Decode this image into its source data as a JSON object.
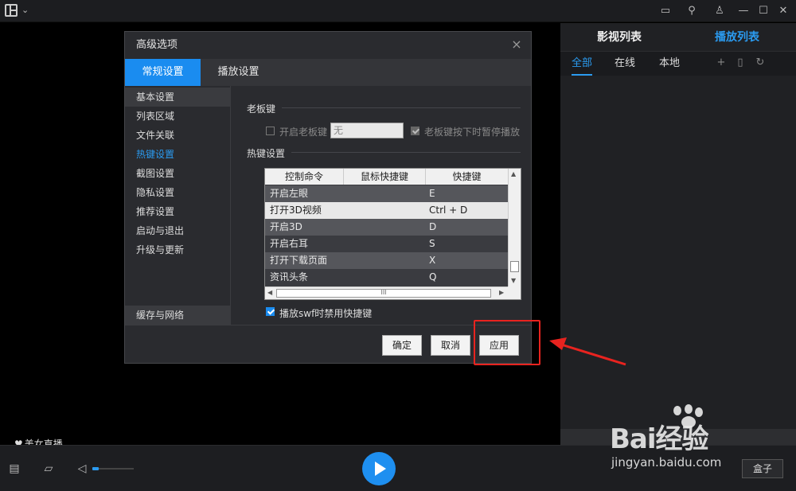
{
  "topbar": {
    "icons": [
      "app-logo-icon",
      "chevron-down-icon",
      "message-icon",
      "pin-icon",
      "skin-icon",
      "minimize-icon",
      "maximize-icon",
      "close-icon"
    ]
  },
  "video": {
    "live_tag": "美女直播"
  },
  "right_panel": {
    "tabs": [
      "影视列表",
      "播放列表"
    ],
    "active_tab": "播放列表",
    "subtabs": [
      "全部",
      "在线",
      "本地"
    ],
    "active_subtab": "全部"
  },
  "dialog": {
    "title": "高级选项",
    "tabs": [
      "常规设置",
      "播放设置"
    ],
    "active_tab": "常规设置",
    "sidebar": {
      "items": [
        "基本设置",
        "列表区域",
        "文件关联",
        "热键设置",
        "截图设置",
        "隐私设置",
        "推荐设置",
        "启动与退出",
        "升级与更新"
      ],
      "active": "热键设置",
      "bottom_item": "缓存与网络"
    },
    "boss_key": {
      "section_label": "老板键",
      "enable_label": "开启老板键",
      "enable_checked": false,
      "input_value": "无",
      "pause_label": "老板键按下时暂停播放",
      "pause_checked": true
    },
    "hotkeys": {
      "section_label": "热键设置",
      "columns": [
        "控制命令",
        "鼠标快捷键",
        "快捷键"
      ],
      "rows": [
        {
          "command": "开启左眼",
          "mouse": "",
          "key": "E"
        },
        {
          "command": "打开3D视频",
          "mouse": "",
          "key": "Ctrl + D"
        },
        {
          "command": "开启3D",
          "mouse": "",
          "key": "D"
        },
        {
          "command": "开启右耳",
          "mouse": "",
          "key": "S"
        },
        {
          "command": "打开下载页面",
          "mouse": "",
          "key": "X"
        },
        {
          "command": "资讯头条",
          "mouse": "",
          "key": "Q"
        }
      ],
      "selected_row": 1,
      "scroll_grip": "III"
    },
    "swf_option": {
      "label": "播放swf时禁用快捷键",
      "checked": true
    },
    "buttons": {
      "ok": "确定",
      "cancel": "取消",
      "apply": "应用"
    }
  },
  "controls": {
    "volume_level": 0.15,
    "box_label": "盒子"
  },
  "watermark": {
    "brand": "Bai经验",
    "url": "jingyan.baidu.com"
  },
  "colors": {
    "accent": "#1a8cf0",
    "annotation": "#e8231f"
  }
}
